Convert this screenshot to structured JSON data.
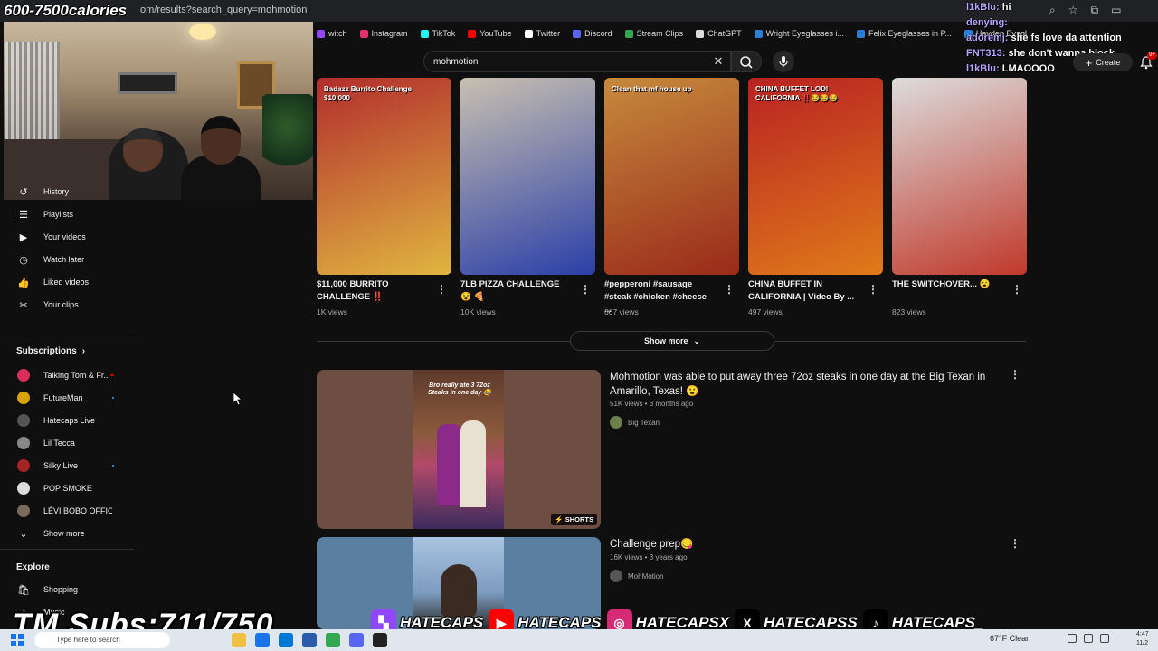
{
  "browser": {
    "url": "om/results?search_query=mohmotion",
    "overlay_title": "600-7500calories",
    "bookmarks": [
      {
        "label": "witch",
        "color": "#9146ff"
      },
      {
        "label": "Instagram",
        "color": "#e1306c"
      },
      {
        "label": "TikTok",
        "color": "#25f4ee"
      },
      {
        "label": "YouTube",
        "color": "#ff0000"
      },
      {
        "label": "Twitter",
        "color": "#ffffff"
      },
      {
        "label": "Discord",
        "color": "#5865f2"
      },
      {
        "label": "Stream Clips",
        "color": "#34a853"
      },
      {
        "label": "ChatGPT",
        "color": "#dddddd"
      },
      {
        "label": "Wright Eyeglasses i...",
        "color": "#2a7fd4"
      },
      {
        "label": "Felix Eyeglasses in P...",
        "color": "#2a7fd4"
      },
      {
        "label": "Hayden Eyegl",
        "color": "#2a7fd4"
      }
    ]
  },
  "chat": [
    {
      "name": "l1kBlu:",
      "msg": " hi"
    },
    {
      "name": "denying:",
      "msg": ""
    },
    {
      "name": "adoremj:",
      "msg": " she fs love da attention"
    },
    {
      "name": "FNT313:",
      "msg": " she don't wanna block"
    },
    {
      "name": "l1kBlu:",
      "msg": " LMAOOOO"
    }
  ],
  "search": {
    "query": "mohmotion",
    "create_label": "Create",
    "notif_count": "9+"
  },
  "sidebar": {
    "items": [
      {
        "label": "History",
        "icon": "history-icon"
      },
      {
        "label": "Playlists",
        "icon": "playlists-icon"
      },
      {
        "label": "Your videos",
        "icon": "your-videos-icon"
      },
      {
        "label": "Watch later",
        "icon": "watch-later-icon"
      },
      {
        "label": "Liked videos",
        "icon": "like-icon"
      },
      {
        "label": "Your clips",
        "icon": "scissors-icon"
      }
    ],
    "subscriptions_title": "Subscriptions",
    "subscriptions": [
      {
        "label": "Talking Tom & Fr...",
        "color": "#d6305a",
        "live": "red"
      },
      {
        "label": "FutureMan",
        "color": "#d9a400",
        "live": "dot"
      },
      {
        "label": "Hatecaps Live",
        "color": "#555555",
        "live": ""
      },
      {
        "label": "Lil Tecca",
        "color": "#888888",
        "live": ""
      },
      {
        "label": "Silky Live",
        "color": "#a42424",
        "live": "dot"
      },
      {
        "label": "POP SMOKE",
        "color": "#dddddd",
        "live": ""
      },
      {
        "label": "LÉVI BOBO OFFICIEL",
        "color": "#7a6a5a",
        "live": ""
      }
    ],
    "show_more": "Show more",
    "explore_title": "Explore",
    "explore": [
      {
        "label": "Shopping",
        "icon": "shopping-bag-icon"
      },
      {
        "label": "Music",
        "icon": "music-icon"
      }
    ]
  },
  "shorts": [
    {
      "title": "$11,000 BURRITO CHALLENGE ‼️",
      "views": "1K views",
      "bg1": "#b22d2d",
      "bg2": "#e0b540",
      "caption": "Badazz Burrito Challenge $10,000"
    },
    {
      "title": "7LB PIZZA CHALLENGE 😵 🍕",
      "views": "10K views",
      "bg1": "#c8c0b0",
      "bg2": "#2b3fa8",
      "caption": ""
    },
    {
      "title": "#pepperoni #sausage #steak #chicken #cheese ...",
      "views": "667 views",
      "bg1": "#c68a3c",
      "bg2": "#9a2a1a",
      "caption": "Clean that mf house up"
    },
    {
      "title": "CHINA BUFFET IN CALIFORNIA | Video By ...",
      "views": "497 views",
      "bg1": "#b82222",
      "bg2": "#e07a1a",
      "caption": "CHINA BUFFET LODI CALIFORNIA ‼️😂😂😂"
    },
    {
      "title": "THE SWITCHOVER... 😮",
      "views": "823 views",
      "bg1": "#dcdcdc",
      "bg2": "#c0392b",
      "caption": ""
    }
  ],
  "show_more_label": "Show more",
  "videos": [
    {
      "title": "Mohmotion was able to put away three 72oz steaks in one day at the Big Texan in Amarillo, Texas! 😮",
      "meta": "51K views • 3 months ago",
      "channel": "Big Texan",
      "badge": "SHORTS",
      "thumb_caption": "Bro really ate 3 72oz Steaks in one day 😂"
    },
    {
      "title": "Challenge prep😋",
      "meta": "16K views • 3 years ago",
      "channel": "MohMotion",
      "badge": "",
      "thumb_caption": ""
    }
  ],
  "overlay": {
    "subs": "TM Subs:711/750",
    "socials": [
      {
        "label": "HATECAPS",
        "color": "#9146ff",
        "icon": "twitch-icon"
      },
      {
        "label": "HATECAPS",
        "color": "#ff0000",
        "icon": "youtube-icon"
      },
      {
        "label": "HATECAPSX",
        "color": "#d62976",
        "icon": "instagram-icon"
      },
      {
        "label": "HATECAPSS",
        "color": "#000000",
        "icon": "x-icon"
      },
      {
        "label": "HATECAPS_",
        "color": "#000000",
        "icon": "tiktok-icon"
      }
    ]
  },
  "taskbar": {
    "search_placeholder": "Type here to search",
    "weather": "67°F  Clear",
    "time": "4:47",
    "date": "11/2"
  }
}
